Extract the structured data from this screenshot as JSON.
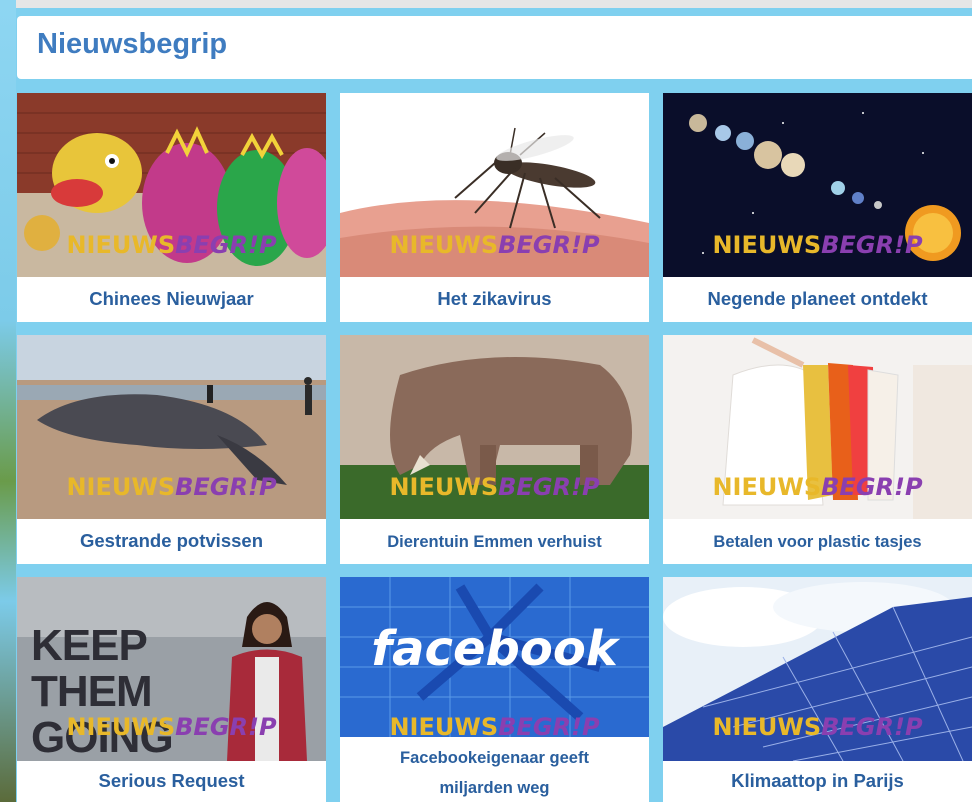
{
  "header": {
    "title": "Nieuwsbegrip"
  },
  "logo": {
    "part1": "NIEUWS",
    "part2": "BEGR!P"
  },
  "cards": [
    {
      "caption": "Chinees Nieuwjaar",
      "image": "chinese-dragon-image"
    },
    {
      "caption": "Het zikavirus",
      "image": "mosquito-image"
    },
    {
      "caption": "Negende planeet ontdekt",
      "image": "solar-system-image"
    },
    {
      "caption": "Gestrande potvissen",
      "image": "stranded-whale-image"
    },
    {
      "caption": "Dierentuin Emmen verhuist",
      "image": "rhinoceros-image"
    },
    {
      "caption": "Betalen voor plastic tasjes",
      "image": "plastic-bags-image"
    },
    {
      "caption": "Serious Request",
      "image": "serious-request-image",
      "image_text": "KEEP THEM GOING"
    },
    {
      "caption": "Facebookeigenaar geeft miljarden weg",
      "image": "facebook-image",
      "image_text": "facebook"
    },
    {
      "caption": "Klimaattop in Parijs",
      "image": "solar-panels-image"
    }
  ]
}
